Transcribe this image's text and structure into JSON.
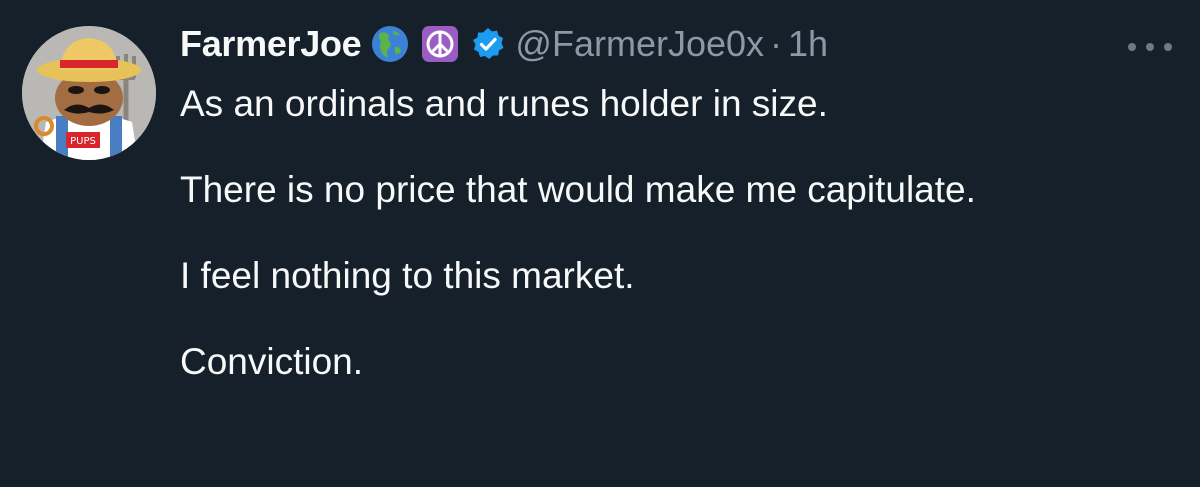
{
  "tweet": {
    "display_name": "FarmerJoe",
    "handle": "@FarmerJoe0x",
    "separator": "·",
    "time": "1h",
    "avatar_text": "PUPS",
    "emojis": [
      "globe-americas-icon",
      "peace-symbol-icon"
    ],
    "lines": [
      "As an ordinals and runes holder in size.",
      "There is no price that would make me capitulate.",
      "I feel nothing to this market.",
      "Conviction."
    ]
  },
  "colors": {
    "background": "#15202b",
    "text": "#f7f9f9",
    "muted": "#8b98a5",
    "verified": "#1d9bf0",
    "peace_bg": "#9b5cc4"
  }
}
